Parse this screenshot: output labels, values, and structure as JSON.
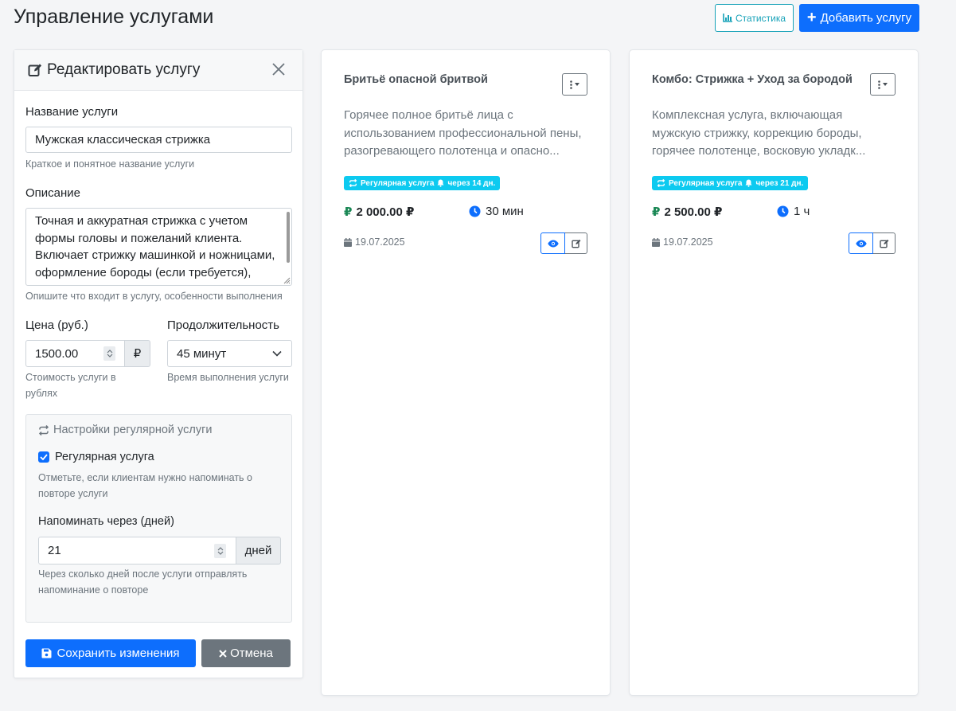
{
  "header": {
    "title": "Управление услугами",
    "stats_label": "Статистика",
    "add_label": "Добавить услугу"
  },
  "edit_form": {
    "title": "Редактировать услугу",
    "name_label": "Название услуги",
    "name_value": "Мужская классическая стрижка",
    "name_hint": "Краткое и понятное название услуги",
    "desc_label": "Описание",
    "desc_value": "Точная и аккуратная стрижка с учетом формы головы и пожеланий клиента. Включает стрижку машинкой и ножницами, оформление бороды (если требуется),",
    "desc_hint": "Опишите что входит в услугу, особенности выполнения",
    "price_label": "Цена (руб.)",
    "price_value": "1500.00",
    "price_addon": "₽",
    "price_hint": "Стоимость услуги в рублях",
    "duration_label": "Продолжительность",
    "duration_value": "45 минут",
    "duration_hint": "Время выполнения услуги",
    "recurring": {
      "title": "Настройки регулярной услуги",
      "checkbox_label": "Регулярная услуга",
      "checkbox_checked": true,
      "checkbox_hint": "Отметьте, если клиентам нужно напоминать о повторе услуги",
      "remind_label": "Напоминать через (дней)",
      "remind_value": "21",
      "remind_addon": "дней",
      "remind_hint": "Через сколько дней после услуги отправлять напоминание о повторе"
    },
    "save_label": "Сохранить изменения",
    "cancel_label": "Отмена"
  },
  "services": [
    {
      "title": "Бритьё опасной бритвой",
      "description": "Горячее полное бритьё лица с использованием профессиональной пены, разогревающего полотенца и опасно...",
      "badge_recurring": "Регулярная услуга",
      "badge_remind": "через 14 дн.",
      "price": "2 000.00 ₽",
      "currency_icon": "₽",
      "duration": "30 мин",
      "date": "19.07.2025"
    },
    {
      "title": "Комбо: Стрижка + Уход за бородой",
      "description": "Комплексная услуга, включающая мужскую стрижку, коррекцию бороды, горячее полотенце, восковую укладк...",
      "badge_recurring": "Регулярная услуга",
      "badge_remind": "через 21 дн.",
      "price": "2 500.00 ₽",
      "currency_icon": "₽",
      "duration": "1 ч",
      "date": "19.07.2025"
    }
  ],
  "colors": {
    "primary": "#0d6efd",
    "info": "#17a2b8",
    "badge": "#0dcaf0",
    "success": "#198754",
    "secondary": "#6c757d"
  }
}
